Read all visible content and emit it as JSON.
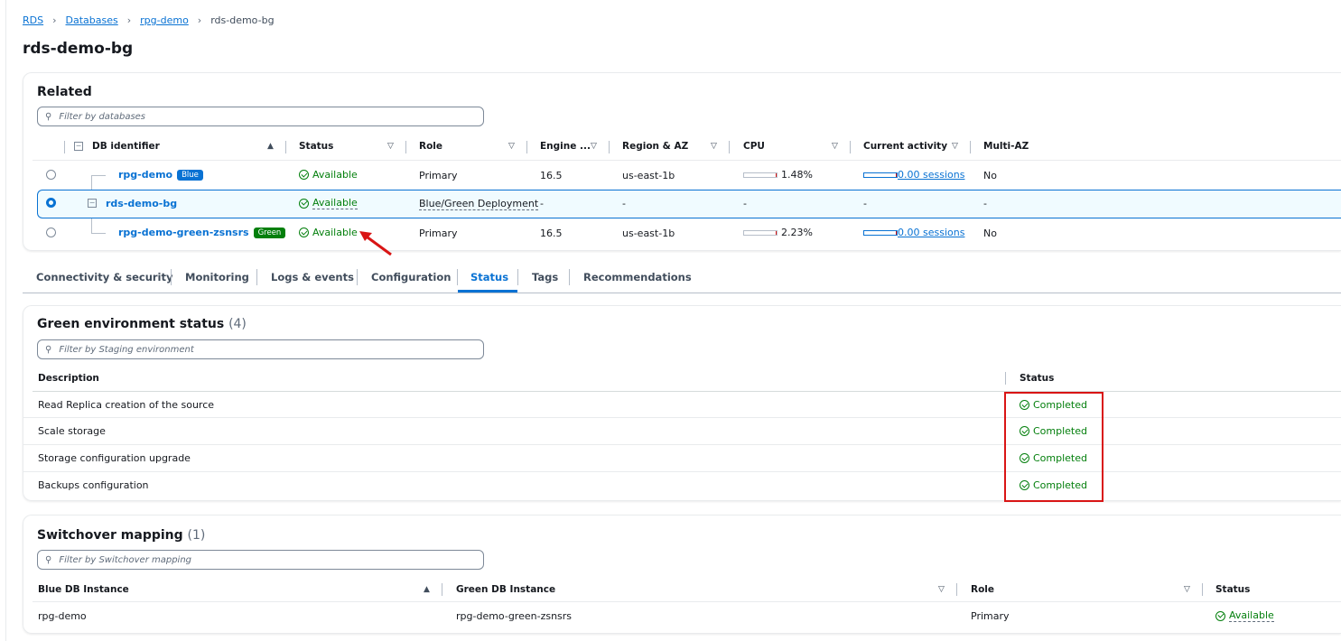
{
  "breadcrumb": [
    "RDS",
    "Databases",
    "rpg-demo",
    "rds-demo-bg"
  ],
  "page_title": "rds-demo-bg",
  "related": {
    "title": "Related",
    "filter_placeholder": "Filter by databases",
    "columns": [
      "DB identifier",
      "Status",
      "Role",
      "Engine ...",
      "Region & AZ",
      "CPU",
      "Current activity",
      "Multi-AZ"
    ],
    "rows": [
      {
        "id": "rpg-demo",
        "badge": "Blue",
        "status": "Available",
        "role": "Primary",
        "engine": "16.5",
        "region": "us-east-1b",
        "cpu": "1.48%",
        "cpu_value": 1.48,
        "activity": "0.00 sessions",
        "multi_az": "No",
        "selected": false
      },
      {
        "id": "rds-demo-bg",
        "badge": "",
        "status": "Available",
        "role": "Blue/Green Deployment",
        "engine": "-",
        "region": "-",
        "cpu": "-",
        "activity": "-",
        "multi_az": "-",
        "selected": true
      },
      {
        "id": "rpg-demo-green-zsnsrs",
        "badge": "Green",
        "status": "Available",
        "role": "Primary",
        "engine": "16.5",
        "region": "us-east-1b",
        "cpu": "2.23%",
        "cpu_value": 2.23,
        "activity": "0.00 sessions",
        "multi_az": "No",
        "selected": false
      }
    ]
  },
  "tabs": [
    "Connectivity & security",
    "Monitoring",
    "Logs & events",
    "Configuration",
    "Status",
    "Tags",
    "Recommendations"
  ],
  "active_tab": "Status",
  "green_status": {
    "title": "Green environment status",
    "count": "(4)",
    "filter_placeholder": "Filter by Staging environment",
    "columns": [
      "Description",
      "Status"
    ],
    "rows": [
      {
        "description": "Read Replica creation of the source",
        "status": "Completed"
      },
      {
        "description": "Scale storage",
        "status": "Completed"
      },
      {
        "description": "Storage configuration upgrade",
        "status": "Completed"
      },
      {
        "description": "Backups configuration",
        "status": "Completed"
      }
    ]
  },
  "switchover": {
    "title": "Switchover mapping",
    "count": "(1)",
    "filter_placeholder": "Filter by Switchover mapping",
    "columns": [
      "Blue DB Instance",
      "Green DB Instance",
      "Role",
      "Status"
    ],
    "rows": [
      {
        "blue": "rpg-demo",
        "green": "rpg-demo-green-zsnsrs",
        "role": "Primary",
        "status": "Available"
      }
    ]
  },
  "colors": {
    "link": "#0972d3",
    "success": "#037f0c",
    "blue_badge": "#0972d3",
    "green_badge": "#037f0c",
    "annotation": "#d91515"
  }
}
